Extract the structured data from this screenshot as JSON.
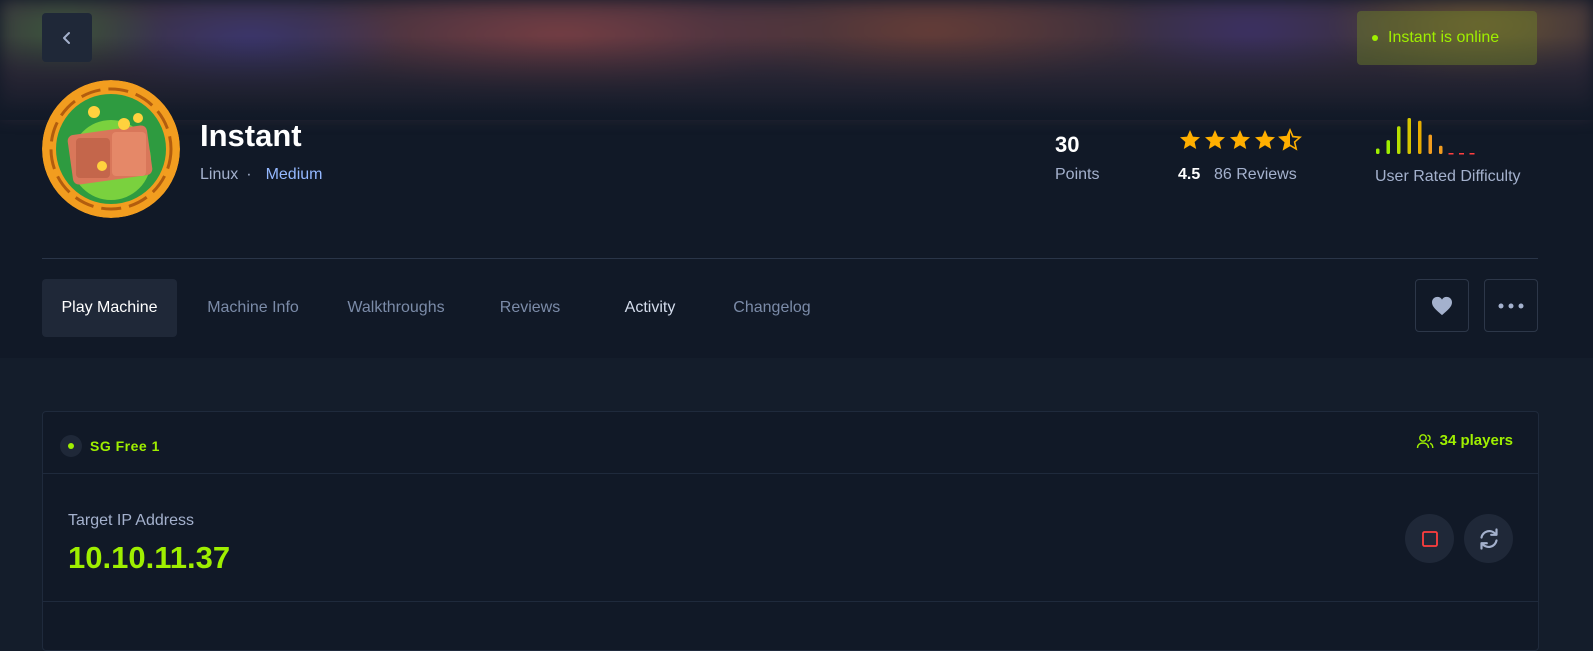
{
  "header": {
    "status": "Instant is online",
    "machine": {
      "name": "Instant",
      "os": "Linux",
      "separator": "·",
      "difficulty": "Medium"
    },
    "stats": {
      "points_value": "30",
      "points_label": "Points",
      "rating_value": "4.5",
      "rating_stars_fraction": 0.9,
      "reviews": "86 Reviews",
      "difficulty_label": "User Rated Difficulty",
      "difficulty_distribution": [
        2,
        5,
        10,
        13,
        12,
        7,
        3,
        0,
        0,
        0
      ]
    }
  },
  "tabs": [
    {
      "label": "Play Machine",
      "active": true
    },
    {
      "label": "Machine Info",
      "active": false
    },
    {
      "label": "Walkthroughs",
      "active": false
    },
    {
      "label": "Reviews",
      "active": false
    },
    {
      "label": "Activity",
      "active": false
    },
    {
      "label": "Changelog",
      "active": false
    }
  ],
  "actions": {
    "favorite_icon": "heart-icon",
    "more_icon": "more-horizontal-icon"
  },
  "instance": {
    "server": "SG Free 1",
    "players": "34 players",
    "ip_label": "Target IP Address",
    "ip_value": "10.10.11.37"
  },
  "colors": {
    "accent": "#9fef00",
    "star": "#ffaf00",
    "stop": "#ff3e3e",
    "difficulty_link": "#94b8ff"
  }
}
